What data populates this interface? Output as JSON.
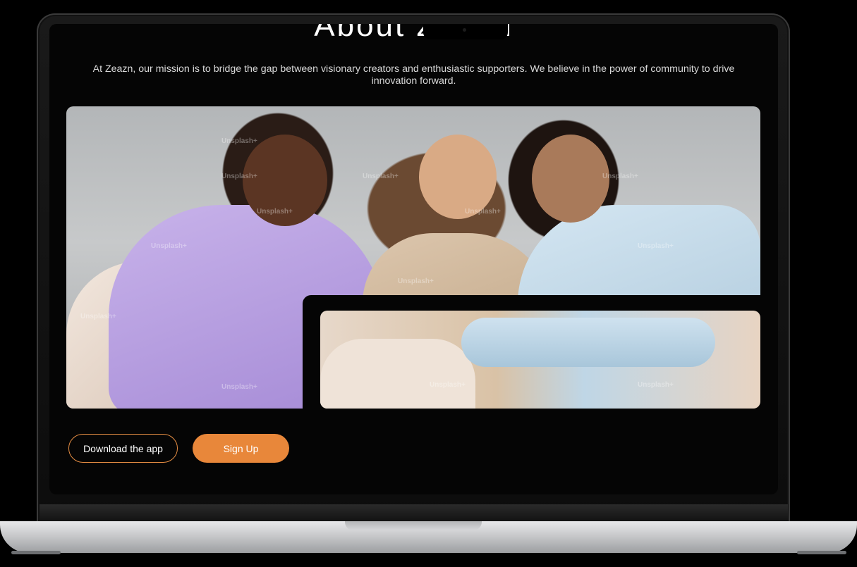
{
  "page": {
    "title": "About Zeazn",
    "mission": "At Zeazn, our mission is to bridge the gap between visionary creators and enthusiastic supporters. We believe in the power of community to drive innovation forward."
  },
  "gallery": {
    "watermark": "Unsplash+"
  },
  "actions": {
    "download_label": "Download the app",
    "signup_label": "Sign Up"
  },
  "colors": {
    "accent": "#e8873a",
    "background": "#050505"
  }
}
